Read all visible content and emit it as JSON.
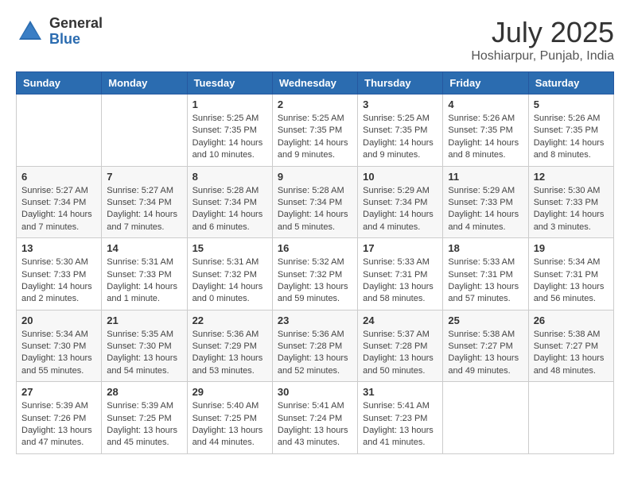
{
  "header": {
    "logo_general": "General",
    "logo_blue": "Blue",
    "month_title": "July 2025",
    "location": "Hoshiarpur, Punjab, India"
  },
  "days_of_week": [
    "Sunday",
    "Monday",
    "Tuesday",
    "Wednesday",
    "Thursday",
    "Friday",
    "Saturday"
  ],
  "weeks": [
    [
      {
        "day": "",
        "info": ""
      },
      {
        "day": "",
        "info": ""
      },
      {
        "day": "1",
        "info": "Sunrise: 5:25 AM\nSunset: 7:35 PM\nDaylight: 14 hours and 10 minutes."
      },
      {
        "day": "2",
        "info": "Sunrise: 5:25 AM\nSunset: 7:35 PM\nDaylight: 14 hours and 9 minutes."
      },
      {
        "day": "3",
        "info": "Sunrise: 5:25 AM\nSunset: 7:35 PM\nDaylight: 14 hours and 9 minutes."
      },
      {
        "day": "4",
        "info": "Sunrise: 5:26 AM\nSunset: 7:35 PM\nDaylight: 14 hours and 8 minutes."
      },
      {
        "day": "5",
        "info": "Sunrise: 5:26 AM\nSunset: 7:35 PM\nDaylight: 14 hours and 8 minutes."
      }
    ],
    [
      {
        "day": "6",
        "info": "Sunrise: 5:27 AM\nSunset: 7:34 PM\nDaylight: 14 hours and 7 minutes."
      },
      {
        "day": "7",
        "info": "Sunrise: 5:27 AM\nSunset: 7:34 PM\nDaylight: 14 hours and 7 minutes."
      },
      {
        "day": "8",
        "info": "Sunrise: 5:28 AM\nSunset: 7:34 PM\nDaylight: 14 hours and 6 minutes."
      },
      {
        "day": "9",
        "info": "Sunrise: 5:28 AM\nSunset: 7:34 PM\nDaylight: 14 hours and 5 minutes."
      },
      {
        "day": "10",
        "info": "Sunrise: 5:29 AM\nSunset: 7:34 PM\nDaylight: 14 hours and 4 minutes."
      },
      {
        "day": "11",
        "info": "Sunrise: 5:29 AM\nSunset: 7:33 PM\nDaylight: 14 hours and 4 minutes."
      },
      {
        "day": "12",
        "info": "Sunrise: 5:30 AM\nSunset: 7:33 PM\nDaylight: 14 hours and 3 minutes."
      }
    ],
    [
      {
        "day": "13",
        "info": "Sunrise: 5:30 AM\nSunset: 7:33 PM\nDaylight: 14 hours and 2 minutes."
      },
      {
        "day": "14",
        "info": "Sunrise: 5:31 AM\nSunset: 7:33 PM\nDaylight: 14 hours and 1 minute."
      },
      {
        "day": "15",
        "info": "Sunrise: 5:31 AM\nSunset: 7:32 PM\nDaylight: 14 hours and 0 minutes."
      },
      {
        "day": "16",
        "info": "Sunrise: 5:32 AM\nSunset: 7:32 PM\nDaylight: 13 hours and 59 minutes."
      },
      {
        "day": "17",
        "info": "Sunrise: 5:33 AM\nSunset: 7:31 PM\nDaylight: 13 hours and 58 minutes."
      },
      {
        "day": "18",
        "info": "Sunrise: 5:33 AM\nSunset: 7:31 PM\nDaylight: 13 hours and 57 minutes."
      },
      {
        "day": "19",
        "info": "Sunrise: 5:34 AM\nSunset: 7:31 PM\nDaylight: 13 hours and 56 minutes."
      }
    ],
    [
      {
        "day": "20",
        "info": "Sunrise: 5:34 AM\nSunset: 7:30 PM\nDaylight: 13 hours and 55 minutes."
      },
      {
        "day": "21",
        "info": "Sunrise: 5:35 AM\nSunset: 7:30 PM\nDaylight: 13 hours and 54 minutes."
      },
      {
        "day": "22",
        "info": "Sunrise: 5:36 AM\nSunset: 7:29 PM\nDaylight: 13 hours and 53 minutes."
      },
      {
        "day": "23",
        "info": "Sunrise: 5:36 AM\nSunset: 7:28 PM\nDaylight: 13 hours and 52 minutes."
      },
      {
        "day": "24",
        "info": "Sunrise: 5:37 AM\nSunset: 7:28 PM\nDaylight: 13 hours and 50 minutes."
      },
      {
        "day": "25",
        "info": "Sunrise: 5:38 AM\nSunset: 7:27 PM\nDaylight: 13 hours and 49 minutes."
      },
      {
        "day": "26",
        "info": "Sunrise: 5:38 AM\nSunset: 7:27 PM\nDaylight: 13 hours and 48 minutes."
      }
    ],
    [
      {
        "day": "27",
        "info": "Sunrise: 5:39 AM\nSunset: 7:26 PM\nDaylight: 13 hours and 47 minutes."
      },
      {
        "day": "28",
        "info": "Sunrise: 5:39 AM\nSunset: 7:25 PM\nDaylight: 13 hours and 45 minutes."
      },
      {
        "day": "29",
        "info": "Sunrise: 5:40 AM\nSunset: 7:25 PM\nDaylight: 13 hours and 44 minutes."
      },
      {
        "day": "30",
        "info": "Sunrise: 5:41 AM\nSunset: 7:24 PM\nDaylight: 13 hours and 43 minutes."
      },
      {
        "day": "31",
        "info": "Sunrise: 5:41 AM\nSunset: 7:23 PM\nDaylight: 13 hours and 41 minutes."
      },
      {
        "day": "",
        "info": ""
      },
      {
        "day": "",
        "info": ""
      }
    ]
  ]
}
